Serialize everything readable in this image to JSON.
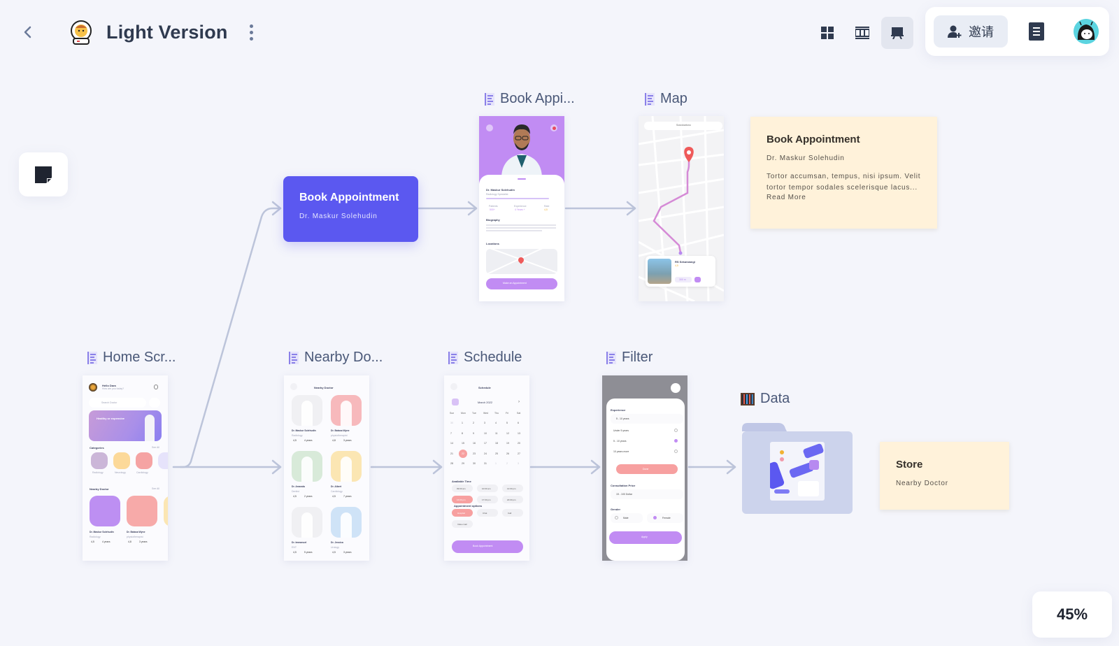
{
  "header": {
    "back_icon": "chevron-left-icon",
    "logo_icon": "astronaut-icon",
    "title": "Light Version",
    "more_icon": "vertical-dots-icon"
  },
  "view_modes": [
    {
      "name": "grid-view",
      "icon": "grid-icon",
      "active": false
    },
    {
      "name": "table-view",
      "icon": "table-icon",
      "active": false
    },
    {
      "name": "presentation-view",
      "icon": "presentation-icon",
      "active": true
    }
  ],
  "top_panel": {
    "invite_label": "邀请",
    "invite_icon": "add-user-icon",
    "document_icon": "document-icon",
    "avatar_icon": "cat-avatar-icon"
  },
  "tools": {
    "sticky_note_icon": "sticky-note-icon"
  },
  "zoom_level": "45%",
  "frames": [
    {
      "id": "book-appointment",
      "label": "Book Appi...",
      "icon": "frame-icon"
    },
    {
      "id": "map",
      "label": "Map",
      "icon": "frame-icon"
    },
    {
      "id": "home-screen",
      "label": "Home Scr...",
      "icon": "frame-icon"
    },
    {
      "id": "nearby-doctor",
      "label": "Nearby Do...",
      "icon": "frame-icon"
    },
    {
      "id": "schedule",
      "label": "Schedule",
      "icon": "frame-icon"
    },
    {
      "id": "filter",
      "label": "Filter",
      "icon": "frame-icon"
    },
    {
      "id": "data",
      "label": "Data",
      "icon": "abacus-icon"
    }
  ],
  "cards": {
    "purple": {
      "title": "Book Appointment",
      "subtitle": "Dr. Maskur Solehudin"
    },
    "note_book": {
      "title": "Book Appointment",
      "subtitle": "Dr. Maskur Solehudin",
      "description": "Tortor accumsan, tempus, nisi ipsum. Velit tortor tempor sodales scelerisque lacus...",
      "read_more": "Read More"
    },
    "note_store": {
      "title": "Store",
      "subtitle": "Nearby Doctor"
    }
  },
  "screens": {
    "home": {
      "greeting": "Hello Dara",
      "greeting_sub": "How are you today?",
      "search_placeholder": "Search Doctor",
      "banner_title": "Healthy or expensive",
      "categories_label": "Categories",
      "see_all": "See All",
      "categories": [
        "Radiology",
        "Neurology",
        "Cardiology",
        "Dentist"
      ],
      "nearby_label": "Nearby Doctor",
      "doctors": [
        {
          "name": "Dr. Maskur Solehudin",
          "spec": "Radiology",
          "rating": "4,5",
          "exp": "4 years"
        },
        {
          "name": "Dr. Batasa Wyne",
          "spec": "physiotherapist",
          "rating": "4,8",
          "exp": "3 years"
        }
      ]
    },
    "book": {
      "name": "Dr. Maskur Solehudin",
      "specialty": "Radiology Specialist",
      "stats": [
        {
          "label": "Patients",
          "value": "500+"
        },
        {
          "label": "Experience",
          "value": "4 Years +"
        },
        {
          "label": "Rate",
          "value": "4,5"
        }
      ],
      "bio_label": "Biography",
      "locations_label": "Locations",
      "cta": "Make an Appointment"
    },
    "map": {
      "search": "Sosrokartono",
      "hospital": "RS Sekarwangi",
      "rating": "4,5",
      "distance": "300 m"
    },
    "nearby": {
      "title": "Nearby Doctor",
      "doctors": [
        {
          "name": "Dr. Maskur Solehudin",
          "spec": "Radiology",
          "rating": "4,5",
          "exp": "4 years",
          "bg": "#f0f0f3"
        },
        {
          "name": "Dr. Batasa Wyne",
          "spec": "physiotherapist",
          "rating": "4,8",
          "exp": "3 years",
          "bg": "#f7b9bc"
        },
        {
          "name": "Dr. Amanda",
          "spec": "Dentist",
          "rating": "4,5",
          "exp": "2 years",
          "bg": "#d8ead9"
        },
        {
          "name": "Dr. Albert",
          "spec": "Cardiology",
          "rating": "4,5",
          "exp": "7 years",
          "bg": "#fbe6b3"
        },
        {
          "name": "Dr. Immanuel",
          "spec": "ENT",
          "rating": "4,5",
          "exp": "5 years",
          "bg": "#f0f0f3"
        },
        {
          "name": "Dr. Jessica",
          "spec": "Urology",
          "rating": "4,5",
          "exp": "3 years",
          "bg": "#cfe3f7"
        }
      ]
    },
    "schedule": {
      "title": "Schedule",
      "month": "March 2022",
      "weekdays": [
        "Sun",
        "Mon",
        "Tue",
        "Wed",
        "Thu",
        "Fri",
        "Sat"
      ],
      "days": [
        "30",
        "1",
        "2",
        "3",
        "4",
        "5",
        "6",
        "7",
        "8",
        "9",
        "10",
        "11",
        "12",
        "13",
        "14",
        "15",
        "16",
        "17",
        "18",
        "19",
        "20",
        "21",
        "22",
        "23",
        "24",
        "25",
        "26",
        "27",
        "28",
        "29",
        "30",
        "31",
        "1",
        "2",
        "3"
      ],
      "selected_day": "22",
      "available_time_label": "Available Time",
      "times": [
        "09:00 am",
        "10:00 am",
        "14:00 pm",
        "16:00 pm",
        "17:00 pm",
        "20:00 pm"
      ],
      "selected_time": "16:00 pm",
      "options_label": "Appointment options",
      "options": [
        "Hospital",
        "Chat",
        "Call",
        "Video Call"
      ],
      "selected_option": "Hospital",
      "cta": "Book Appointment"
    },
    "filter": {
      "experience_label": "Experience",
      "experience_value": "5 - 10 years",
      "experience_options": [
        "Under 5 years",
        "5 - 10 years",
        "10 years more"
      ],
      "selected_experience": "5 - 10 years",
      "done": "Done",
      "price_label": "Consultation Price",
      "price_value": "15 - 100 Dollar",
      "gender_label": "Gender",
      "genders": [
        "Male",
        "Female"
      ],
      "selected_gender": "Female",
      "apply": "Apply"
    }
  },
  "colors": {
    "canvas": "#f4f5fb",
    "accent": "#5b58f0",
    "note": "#fff2da",
    "connector": "#b9c2d8",
    "mini_purple": "#c190f4",
    "mini_coral": "#f7a0a0"
  }
}
